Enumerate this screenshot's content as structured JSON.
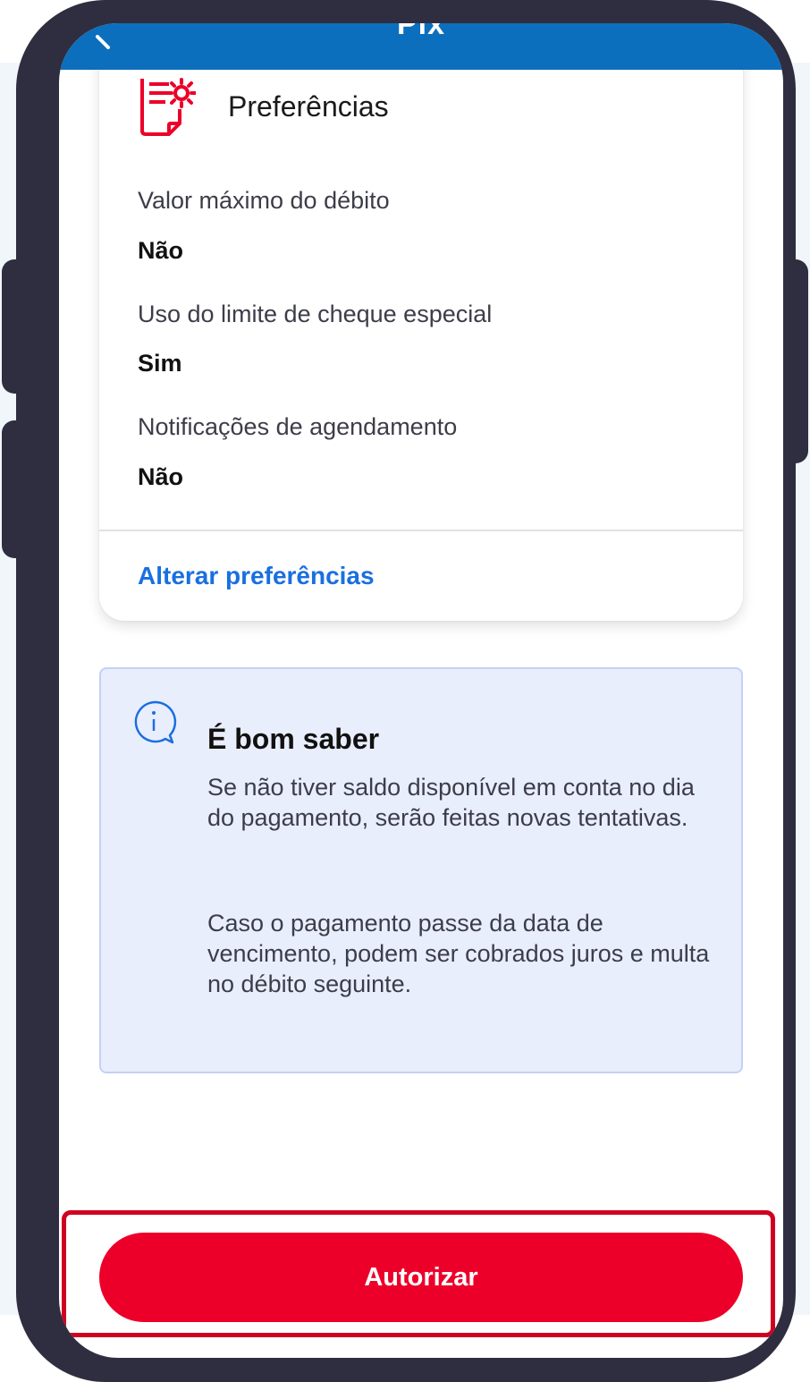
{
  "header": {
    "title": "Pix"
  },
  "preferences": {
    "title": "Preferências",
    "icon": "document-gear-icon",
    "fields": [
      {
        "label": "Valor máximo do débito",
        "value": "Não"
      },
      {
        "label": "Uso do limite de cheque especial",
        "value": "Sim"
      },
      {
        "label": "Notificações de agendamento",
        "value": "Não"
      }
    ],
    "change_link": "Alterar preferências"
  },
  "info": {
    "icon": "info-chat-icon",
    "title": "É bom saber",
    "paragraphs": [
      "Se não tiver saldo disponível em conta no dia do pagamento, serão feitas novas tentativas.",
      "Caso o pagamento passe da data de vencimento, podem ser cobrados juros e multa no débito seguinte."
    ]
  },
  "actions": {
    "authorize_label": "Autorizar"
  },
  "colors": {
    "header_blue": "#0c6fbd",
    "accent_red": "#ec0029",
    "link_blue": "#1a6fe0",
    "info_background": "#e9eefc",
    "highlight_border": "#d00020",
    "device_frame": "#2e2e40"
  }
}
